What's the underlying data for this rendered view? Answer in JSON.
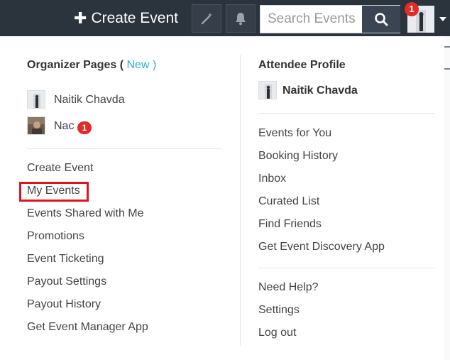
{
  "topbar": {
    "create_event_icon": "plus-icon",
    "create_event_label": "Create Event",
    "magic_icon": "magic-wand-icon",
    "bell_icon": "bell-icon",
    "search": {
      "placeholder": "Search Events",
      "icon": "search-icon"
    },
    "notification_count": "1",
    "avatar_caret_icon": "caret-down-icon"
  },
  "organizer": {
    "title": "Organizer Pages (",
    "new_label": "New",
    "title_close": ")",
    "pages": [
      {
        "name": "Naitik Chavda"
      },
      {
        "name": "Nac",
        "badge": "1"
      }
    ],
    "links": [
      "Create Event",
      "My Events",
      "Events Shared with Me",
      "Promotions",
      "Event Ticketing",
      "Payout Settings",
      "Payout History",
      "Get Event Manager App"
    ]
  },
  "attendee": {
    "title": "Attendee Profile",
    "profile_name": "Naitik Chavda",
    "links": [
      "Events for You",
      "Booking History",
      "Inbox",
      "Curated List",
      "Find Friends",
      "Get Event Discovery App"
    ],
    "help_links": [
      "Need Help?",
      "Settings",
      "Log out"
    ]
  },
  "colors": {
    "topbar_bg": "#2b333d",
    "accent_new": "#2ab0d9",
    "badge_red": "#e02b27",
    "highlight_red": "#e0141a"
  }
}
